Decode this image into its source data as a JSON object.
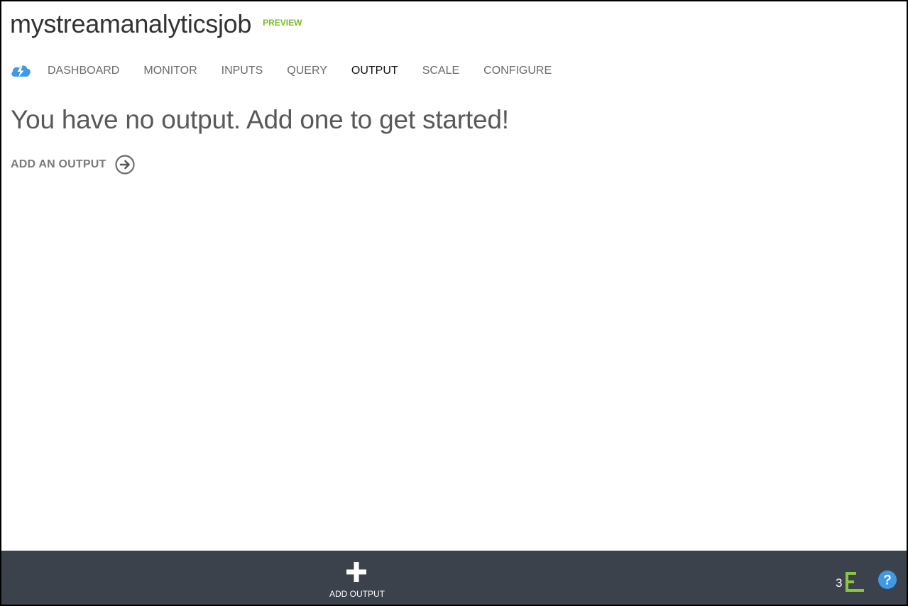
{
  "header": {
    "title": "mystreamanalyticsjob",
    "badge": "PREVIEW",
    "service_icon": "stream-analytics-cloud-icon"
  },
  "tabs": [
    {
      "label": "DASHBOARD",
      "active": false
    },
    {
      "label": "MONITOR",
      "active": false
    },
    {
      "label": "INPUTS",
      "active": false
    },
    {
      "label": "QUERY",
      "active": false
    },
    {
      "label": "OUTPUT",
      "active": true
    },
    {
      "label": "SCALE",
      "active": false
    },
    {
      "label": "CONFIGURE",
      "active": false
    }
  ],
  "main": {
    "empty_message": "You have no output. Add one to get started!",
    "add_link_label": "ADD AN OUTPUT",
    "add_link_icon": "arrow-right-circle-icon"
  },
  "command_bar": {
    "add_output_label": "ADD OUTPUT",
    "add_output_icon": "plus-icon",
    "notification_count": "3",
    "progress_icon": "progress-bars-icon",
    "help_icon": "help-icon"
  },
  "colors": {
    "badge": "#79bd28",
    "command_bar_bg": "#3b424c",
    "accent_blue": "#3f9ae6",
    "progress_green": "#8cc63f"
  }
}
